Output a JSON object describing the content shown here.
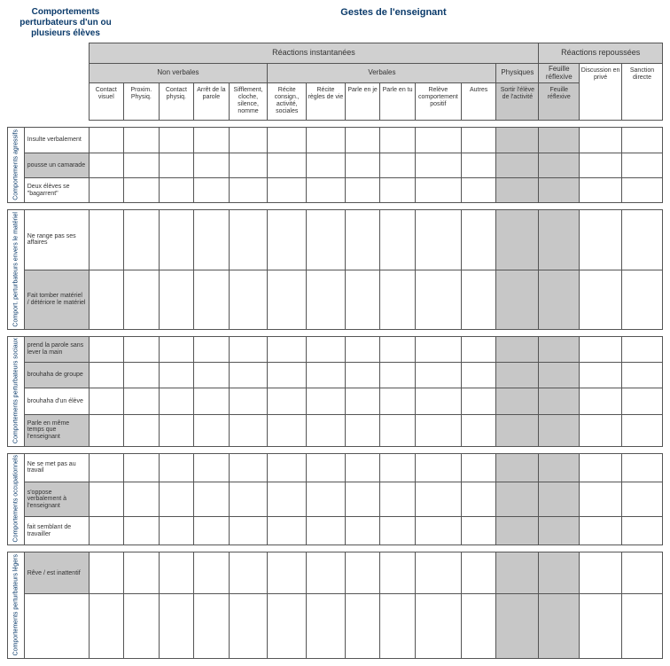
{
  "titles": {
    "left": "Comportements perturbateurs d'un ou plusieurs élèves",
    "main": "Gestes de l'enseignant"
  },
  "header": {
    "instant": "Réactions instantanées",
    "delayed": "Réactions repoussées",
    "nonverbal": "Non verbales",
    "verbal": "Verbales",
    "phys": "Physiques",
    "reflex": "Feuille réflexive",
    "cols": {
      "c1": "Contact visuel",
      "c2": "Proxim. Physiq.",
      "c3": "Contact physiq.",
      "c4": "Arrêt de la parole",
      "c5": "Sifflement, cloche, silence, nomme",
      "c6": "Récite consign., activité, sociales",
      "c7": "Récite règles de vie",
      "c8": "Parle en je",
      "c9": "Parle en tu",
      "c10": "Relève comportement positif",
      "c11": "Autres",
      "c12": "Sortir l'élève de l'activité",
      "c13": "Feuille réflexive",
      "c14": "Discussion en privé",
      "c15": "Sanction directe"
    }
  },
  "groups": {
    "g1": {
      "label": "Comportements agressifs",
      "rows": {
        "r1": "Insulte verbalement",
        "r2": "pousse un camarade",
        "r3": "Deux élèves se \"bagarrent\""
      }
    },
    "g2": {
      "label": "Comport. perturbateurs envers le matériel",
      "rows": {
        "r1": "Ne range pas ses affaires",
        "r2": "Fait tomber matériel / détériore le matériel"
      }
    },
    "g3": {
      "label": "Comportements perturbateurs sociaux",
      "rows": {
        "r1": "prend la parole sans lever la main",
        "r2": "brouhaha de groupe",
        "r3": "brouhaha d'un élève",
        "r4": "Parle en même temps que l'enseignant"
      }
    },
    "g4": {
      "label": "Comportements occupationnels",
      "rows": {
        "r1": "Ne se met pas au travail",
        "r2": "s'oppose verbalement à l'enseignant",
        "r3": "fait semblant de travailler"
      }
    },
    "g5": {
      "label": "Comportements perturbateurs légers",
      "rows": {
        "r1": "Rêve / est inattentif"
      }
    }
  }
}
